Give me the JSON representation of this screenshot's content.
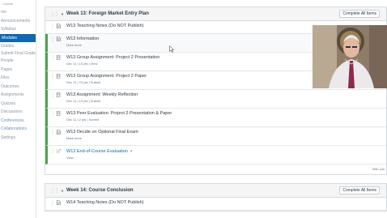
{
  "nav": {
    "header": "Course",
    "items": [
      {
        "label": "me",
        "state": "normal"
      },
      {
        "label": "Announcements",
        "state": "normal"
      },
      {
        "label": "Syllabus",
        "state": "normal"
      },
      {
        "label": "Modules",
        "state": "active"
      },
      {
        "label": "Grades",
        "state": "normal"
      },
      {
        "label": "Submit Final Grades",
        "state": "normal"
      },
      {
        "label": "People",
        "state": "normal"
      },
      {
        "label": "Pages",
        "state": "normal"
      },
      {
        "label": "Files",
        "state": "normal"
      },
      {
        "label": "Outcomes",
        "state": "normal"
      },
      {
        "label": "Assignments",
        "state": "normal"
      },
      {
        "label": "Quizzes",
        "state": "normal"
      },
      {
        "label": "Discussions",
        "state": "normal"
      },
      {
        "label": "Conferences",
        "state": "blue"
      },
      {
        "label": "Collaborations",
        "state": "blue"
      },
      {
        "label": "Settings",
        "state": "normal"
      }
    ]
  },
  "modules": [
    {
      "title": "Week 13: Foreign Market Entry Plan",
      "complete_label": "Complete All Items",
      "items": [
        {
          "title": "W13 Teaching Notes (Do NOT Publish)",
          "meta": "",
          "link": false
        },
        {
          "title": "W13 Information",
          "meta": "Mark done",
          "link": false
        },
        {
          "title": "W13 Group Assignment: Project 2 Presentation",
          "meta": "Dec 11  |  10 pts  |  View",
          "link": false
        },
        {
          "title": "W13 Group Assignment: Project 2 Paper",
          "meta": "Dec 11  |  70 pts  |  Submit",
          "link": false
        },
        {
          "title": "W13 Assignment: Weekly Reflection",
          "meta": "Dec 11  |  10 pts  |  Submit",
          "link": false
        },
        {
          "title": "W13 Peer Evaluation: Project 2 Presentation & Paper",
          "meta": "Dec 11  |  2 pts  |  Submit",
          "link": false
        },
        {
          "title": "W13 Decide on Optional Final Exam",
          "meta": "Mark done",
          "link": false
        },
        {
          "title": "W13 End-of-Course Evaluation",
          "meta": "View",
          "link": true
        }
      ],
      "footer_note": "Will unlo"
    },
    {
      "title": "Week 14: Course Conclusion",
      "complete_label": "Complete All Items",
      "items": [
        {
          "title": "W14 Teaching Notes (Do NOT Publish)",
          "meta": "",
          "link": false
        }
      ]
    }
  ],
  "colors": {
    "active_nav": "#0e68b3",
    "completed_edge": "#4fa34f",
    "link": "#0e68b3"
  }
}
